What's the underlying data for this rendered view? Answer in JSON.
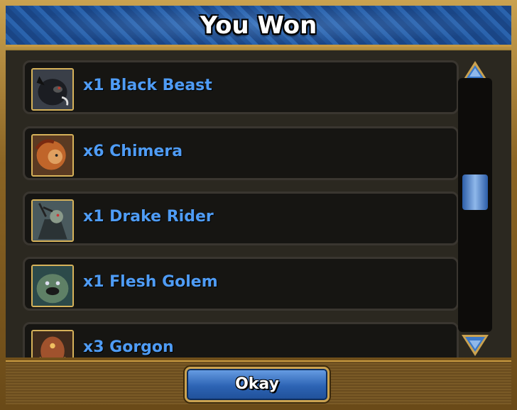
{
  "dialog": {
    "title": "You Won",
    "ok_label": "Okay"
  },
  "rewards": [
    {
      "label": "x1 Black Beast",
      "icon": "black-beast-portrait"
    },
    {
      "label": "x6 Chimera",
      "icon": "chimera-portrait"
    },
    {
      "label": "x1 Drake Rider",
      "icon": "drake-rider-portrait"
    },
    {
      "label": "x1 Flesh Golem",
      "icon": "flesh-golem-portrait"
    },
    {
      "label": "x3 Gorgon",
      "icon": "gorgon-portrait"
    }
  ],
  "colors": {
    "label_blue": "#4f9cf5",
    "header_blue": "#1f539a",
    "gold_border": "#caa250"
  }
}
